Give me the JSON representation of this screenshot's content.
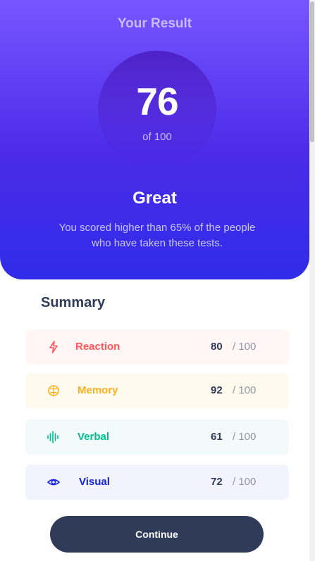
{
  "result": {
    "heading": "Your Result",
    "score": "76",
    "score_max": "of 100",
    "title": "Great",
    "description": "You scored higher than 65% of the people who have taken these tests."
  },
  "summary": {
    "title": "Summary",
    "items": [
      {
        "label": "Reaction",
        "score": "80",
        "max": "/ 100",
        "icon": "lightning-icon",
        "color": "#ff5757",
        "bg": "#fff6f5"
      },
      {
        "label": "Memory",
        "score": "92",
        "max": "/ 100",
        "icon": "brain-icon",
        "color": "#ffb01f",
        "bg": "#fffaee"
      },
      {
        "label": "Verbal",
        "score": "61",
        "max": "/ 100",
        "icon": "soundwave-icon",
        "color": "#00bb8f",
        "bg": "#f2fbfa"
      },
      {
        "label": "Visual",
        "score": "72",
        "max": "/ 100",
        "icon": "eye-icon",
        "color": "#1125d6",
        "bg": "#f3f3fd"
      }
    ]
  },
  "actions": {
    "continue_label": "Continue"
  },
  "colors": {
    "gradient_top": "#7755ff",
    "gradient_bottom": "#2f2ce9",
    "dark_navy": "#303b59"
  }
}
